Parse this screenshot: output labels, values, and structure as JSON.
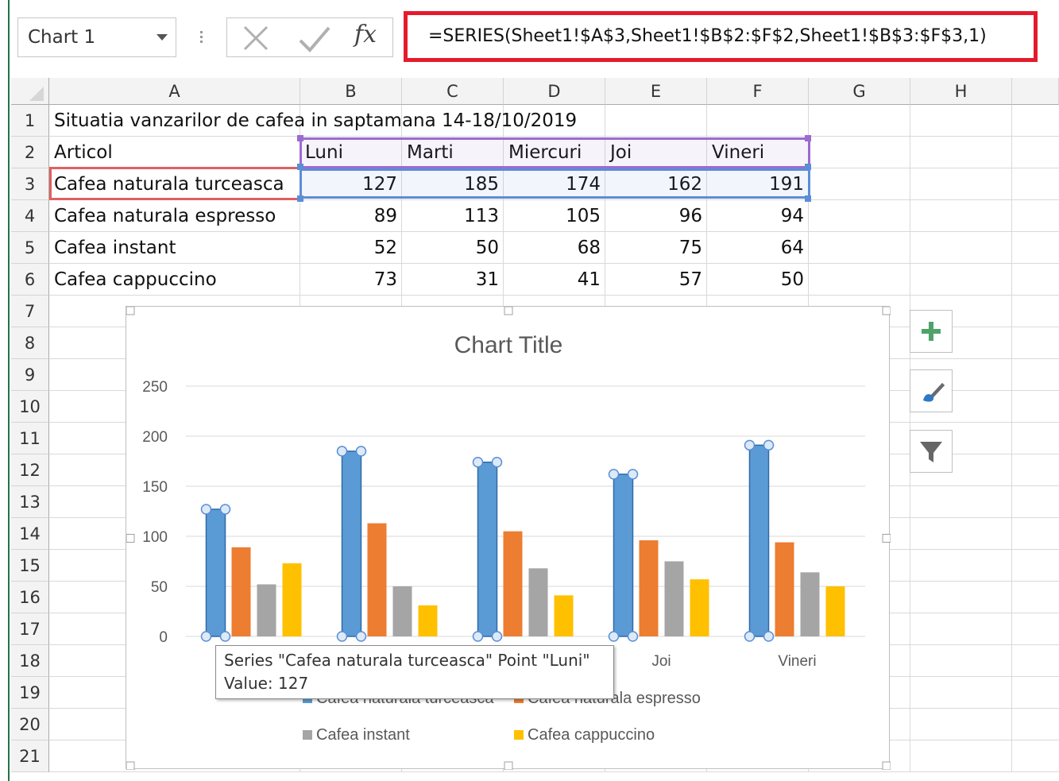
{
  "name_box": {
    "value": "Chart 1"
  },
  "formula_bar": {
    "cancel_icon": "x-icon",
    "enter_icon": "check-icon",
    "fx_label": "fx",
    "formula": "=SERIES(Sheet1!$A$3,Sheet1!$B$2:$F$2,Sheet1!$B$3:$F$3,1)"
  },
  "sheet": {
    "columns": [
      "A",
      "B",
      "C",
      "D",
      "E",
      "F",
      "G",
      "H"
    ],
    "rows": [
      "1",
      "2",
      "3",
      "4",
      "5",
      "6",
      "7",
      "8",
      "9",
      "10",
      "11",
      "12",
      "13",
      "14",
      "15",
      "16",
      "17",
      "18",
      "19",
      "20",
      "21"
    ],
    "title": "Situatia vanzarilor de cafea in saptamana 14-18/10/2019",
    "header_row": {
      "label": "Articol",
      "days": [
        "Luni",
        "Marti",
        "Miercuri",
        "Joi",
        "Vineri"
      ]
    },
    "data_rows": [
      {
        "name": "Cafea naturala turceasca",
        "values": [
          "127",
          "185",
          "174",
          "162",
          "191"
        ]
      },
      {
        "name": "Cafea naturala espresso",
        "values": [
          "89",
          "113",
          "105",
          "96",
          "94"
        ]
      },
      {
        "name": "Cafea instant",
        "values": [
          "52",
          "50",
          "68",
          "75",
          "64"
        ]
      },
      {
        "name": "Cafea cappuccino",
        "values": [
          "73",
          "31",
          "41",
          "57",
          "50"
        ]
      }
    ]
  },
  "chart_data": {
    "type": "bar",
    "title": "Chart Title",
    "categories": [
      "Luni",
      "Marti",
      "Miercuri",
      "Joi",
      "Vineri"
    ],
    "visible_category_labels": [
      "Joi",
      "Vineri"
    ],
    "series": [
      {
        "name": "Cafea naturala turceasca",
        "values": [
          127,
          185,
          174,
          162,
          191
        ],
        "color": "#5b9bd5"
      },
      {
        "name": "Cafea naturala espresso",
        "values": [
          89,
          113,
          105,
          96,
          94
        ],
        "color": "#ed7d31"
      },
      {
        "name": "Cafea instant",
        "values": [
          52,
          50,
          68,
          75,
          64
        ],
        "color": "#a5a5a5"
      },
      {
        "name": "Cafea cappuccino",
        "values": [
          73,
          31,
          41,
          57,
          50
        ],
        "color": "#ffc000"
      }
    ],
    "ylim": [
      0,
      250
    ],
    "yticks": [
      "0",
      "50",
      "100",
      "150",
      "200",
      "250"
    ],
    "grid": true,
    "legend_position": "bottom",
    "selected_series": "Cafea naturala turceasca"
  },
  "chart_tools": {
    "add_icon": "plus-icon",
    "style_icon": "brush-icon",
    "filter_icon": "filter-icon"
  },
  "tooltip": {
    "line1": "Series \"Cafea naturala turceasca\" Point \"Luni\"",
    "line2": "Value: 127"
  },
  "colors": {
    "accent": "#217346",
    "formula_highlight": "#e51a2c",
    "range_purple": "#9b6bd0",
    "range_blue": "#5b8ed6",
    "range_red": "#e06060"
  }
}
